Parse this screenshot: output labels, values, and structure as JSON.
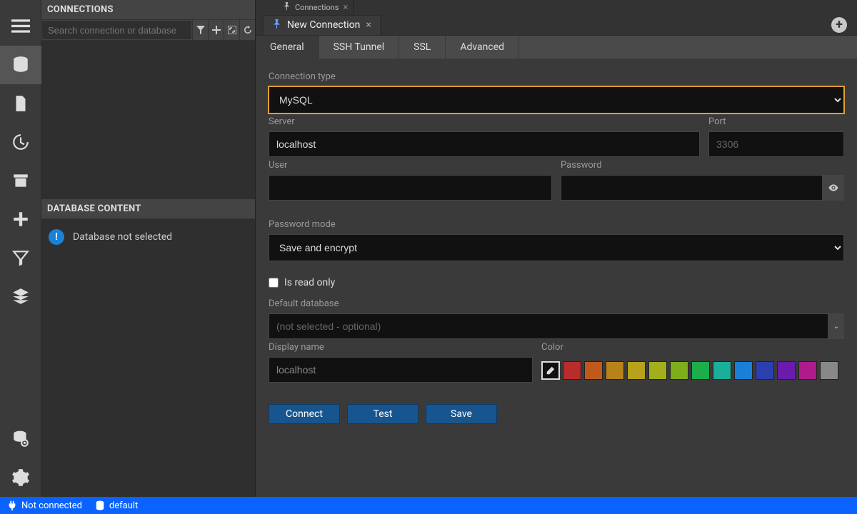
{
  "sidebar": {
    "connections_header": "CONNECTIONS",
    "search_placeholder": "Search connection or database",
    "db_content_header": "DATABASE CONTENT",
    "db_notice": "Database not selected"
  },
  "topTabs": {
    "tab0": "Connections"
  },
  "docTitle": "New Connection",
  "innerTabs": {
    "general": "General",
    "ssh": "SSH Tunnel",
    "ssl": "SSL",
    "advanced": "Advanced"
  },
  "form": {
    "connection_type_label": "Connection type",
    "connection_type_value": "MySQL",
    "server_label": "Server",
    "server_value": "localhost",
    "port_label": "Port",
    "port_placeholder": "3306",
    "user_label": "User",
    "password_label": "Password",
    "password_mode_label": "Password mode",
    "password_mode_value": "Save and encrypt",
    "read_only_label": "Is read only",
    "default_db_label": "Default database",
    "default_db_placeholder": "(not selected - optional)",
    "display_name_label": "Display name",
    "display_name_value": "localhost",
    "color_label": "Color",
    "connect_btn": "Connect",
    "test_btn": "Test",
    "save_btn": "Save"
  },
  "colors": [
    "#b82c2c",
    "#c05a1b",
    "#b8821b",
    "#b8a11b",
    "#a3ae1b",
    "#7fae1b",
    "#1bae4b",
    "#1bae9b",
    "#1b7fd6",
    "#2b3fae",
    "#6a1bae",
    "#ae1b8b",
    "#888888"
  ],
  "status": {
    "conn": "Not connected",
    "db": "default"
  }
}
